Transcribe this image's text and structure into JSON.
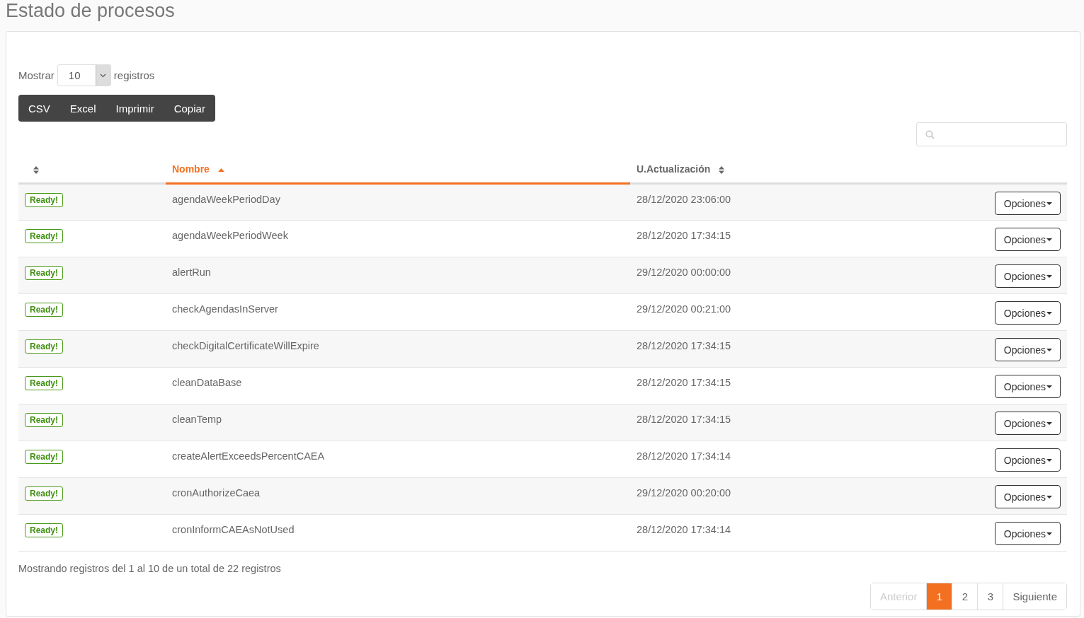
{
  "page_title": "Estado de procesos",
  "length_control": {
    "prefix": "Mostrar",
    "value": "10",
    "suffix": "registros"
  },
  "export_buttons": [
    "CSV",
    "Excel",
    "Imprimir",
    "Copiar"
  ],
  "table": {
    "columns": [
      {
        "sorted": false
      },
      {
        "label": "Nombre",
        "sorted": true
      },
      {
        "label": "U.Actualización",
        "sorted": false
      }
    ],
    "rows": [
      {
        "status": "Ready!",
        "name": "agendaWeekPeriodDay",
        "updated": "28/12/2020 23:06:00",
        "action": "Opciones"
      },
      {
        "status": "Ready!",
        "name": "agendaWeekPeriodWeek",
        "updated": "28/12/2020 17:34:15",
        "action": "Opciones"
      },
      {
        "status": "Ready!",
        "name": "alertRun",
        "updated": "29/12/2020 00:00:00",
        "action": "Opciones"
      },
      {
        "status": "Ready!",
        "name": "checkAgendasInServer",
        "updated": "29/12/2020 00:21:00",
        "action": "Opciones"
      },
      {
        "status": "Ready!",
        "name": "checkDigitalCertificateWillExpire",
        "updated": "28/12/2020 17:34:15",
        "action": "Opciones"
      },
      {
        "status": "Ready!",
        "name": "cleanDataBase",
        "updated": "28/12/2020 17:34:15",
        "action": "Opciones"
      },
      {
        "status": "Ready!",
        "name": "cleanTemp",
        "updated": "28/12/2020 17:34:15",
        "action": "Opciones"
      },
      {
        "status": "Ready!",
        "name": "createAlertExceedsPercentCAEA",
        "updated": "28/12/2020 17:34:14",
        "action": "Opciones"
      },
      {
        "status": "Ready!",
        "name": "cronAuthorizeCaea",
        "updated": "29/12/2020 00:20:00",
        "action": "Opciones"
      },
      {
        "status": "Ready!",
        "name": "cronInformCAEAsNotUsed",
        "updated": "28/12/2020 17:34:14",
        "action": "Opciones"
      }
    ]
  },
  "info": "Mostrando registros del 1 al 10 de un total de 22 registros",
  "pagination": [
    {
      "label": "Anterior",
      "selected": false,
      "disabled": true
    },
    {
      "label": "1",
      "selected": true,
      "disabled": false
    },
    {
      "label": "2",
      "selected": false,
      "disabled": false
    },
    {
      "label": "3",
      "selected": false,
      "disabled": false
    },
    {
      "label": "Siguiente",
      "selected": false,
      "disabled": false
    }
  ]
}
